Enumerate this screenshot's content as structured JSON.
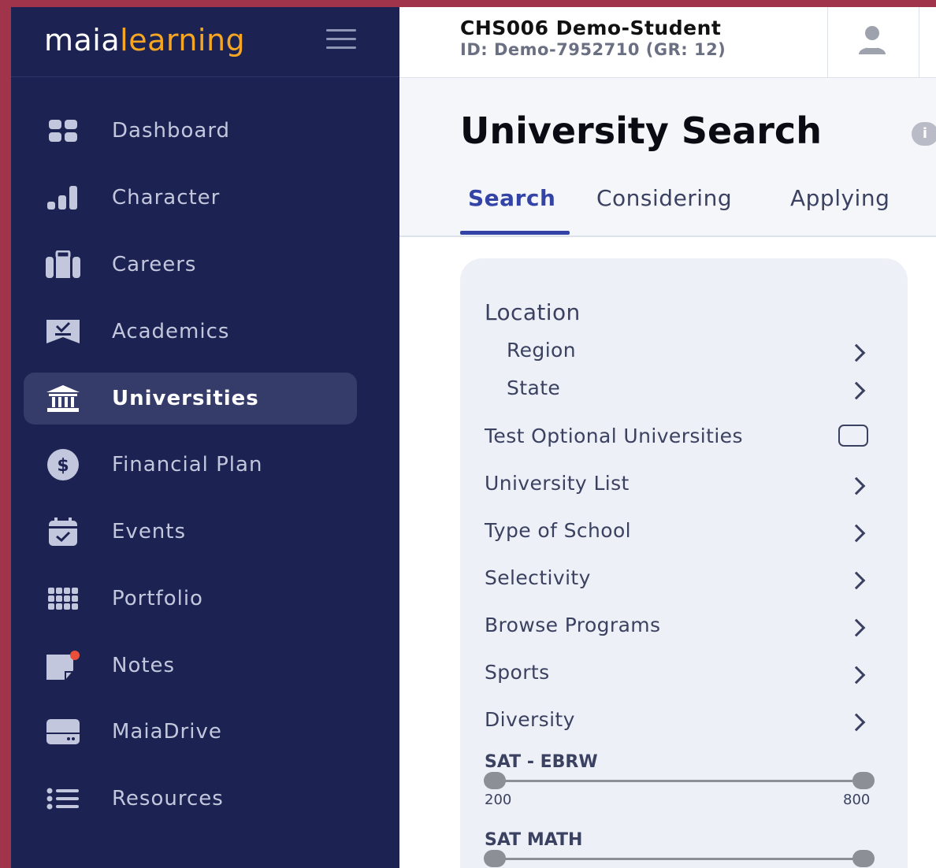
{
  "brand": {
    "part1": "maia",
    "part2": "learning"
  },
  "sidebar": {
    "items": [
      {
        "label": "Dashboard"
      },
      {
        "label": "Character"
      },
      {
        "label": "Careers"
      },
      {
        "label": "Academics"
      },
      {
        "label": "Universities",
        "active": true
      },
      {
        "label": "Financial Plan"
      },
      {
        "label": "Events"
      },
      {
        "label": "Portfolio"
      },
      {
        "label": "Notes"
      },
      {
        "label": "MaiaDrive"
      },
      {
        "label": "Resources"
      }
    ]
  },
  "header": {
    "student_name": "CHS006 Demo-Student",
    "student_id": "ID: Demo-7952710 (GR: 12)"
  },
  "page": {
    "title": "University Search",
    "info_glyph": "i",
    "tabs": [
      {
        "label": "Search",
        "active": true
      },
      {
        "label": "Considering"
      },
      {
        "label": "Applying"
      }
    ]
  },
  "filters": {
    "location": "Location",
    "region": "Region",
    "state": "State",
    "test_optional": "Test Optional Universities",
    "test_optional_checked": false,
    "university_list": "University List",
    "type_of_school": "Type of School",
    "selectivity": "Selectivity",
    "browse_programs": "Browse Programs",
    "sports": "Sports",
    "diversity": "Diversity",
    "sat_ebrw": {
      "label": "SAT - EBRW",
      "min": "200",
      "max": "800"
    },
    "sat_math": {
      "label": "SAT MATH"
    }
  },
  "colors": {
    "sidebar_bg": "#1c2352",
    "accent": "#3344a6",
    "brand_orange": "#f5a623",
    "notification_dot": "#e8503a"
  }
}
